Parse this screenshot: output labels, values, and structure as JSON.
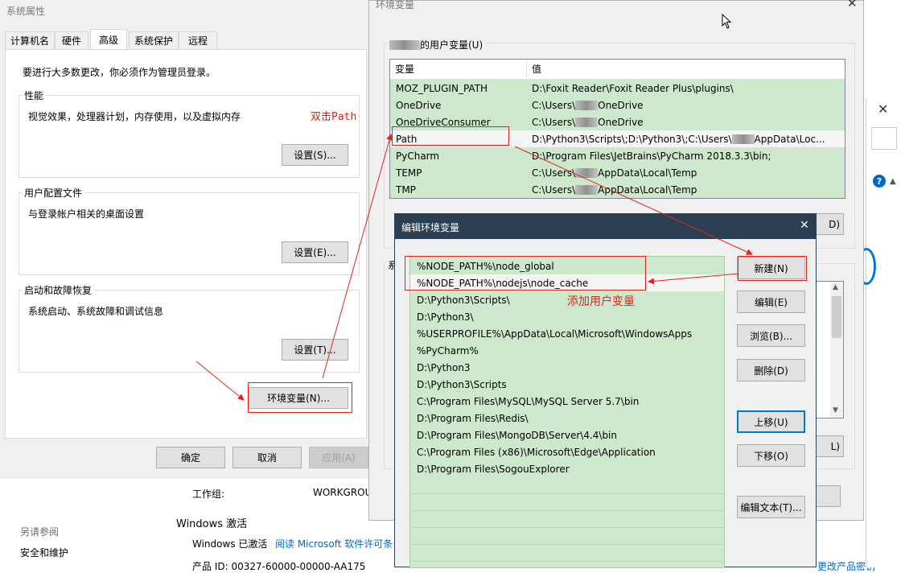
{
  "sysprop": {
    "title": "系统属性",
    "tabs": [
      "计算机名",
      "硬件",
      "高级",
      "系统保护",
      "远程"
    ],
    "admin_note": "要进行大多数更改，你必须作为管理员登录。",
    "perf_title": "性能",
    "perf_desc": "视觉效果，处理器计划，内存使用，以及虚拟内存",
    "perf_btn": "设置(S)...",
    "profile_title": "用户配置文件",
    "profile_desc": "与登录帐户相关的桌面设置",
    "profile_btn": "设置(E)...",
    "startup_title": "启动和故障恢复",
    "startup_desc": "系统启动、系统故障和调试信息",
    "startup_btn": "设置(T)...",
    "env_btn": "环境变量(N)...",
    "ok": "确定",
    "cancel": "取消",
    "apply": "应用(A)"
  },
  "background": {
    "workgroup_label": "工作组:",
    "workgroup_value": "WORKGROU",
    "see_also": "另请参阅",
    "security": "安全和维护",
    "activation_title": "Windows 激活",
    "activated": "Windows 已激活",
    "license_link": "阅读 Microsoft 软件许可条",
    "product_id": "产品 ID: 00327-60000-00000-AA175",
    "right_link": "更改产品密钥"
  },
  "envvars": {
    "title": "环境变量",
    "user_group_title": "的用户变量(U)",
    "col_var": "变量",
    "col_val": "值",
    "rows": [
      {
        "name": "MOZ_PLUGIN_PATH",
        "value": "D:\\Foxit Reader\\Foxit Reader Plus\\plugins\\"
      },
      {
        "name": "OneDrive",
        "value_a": "C:\\Users\\",
        "value_b": "OneDrive"
      },
      {
        "name": "OneDriveConsumer",
        "value_a": "C:\\Users\\",
        "value_b": "OneDrive"
      },
      {
        "name": "Path",
        "value_a": "D:\\Python3\\Scripts\\;D:\\Python3\\;C:\\Users\\",
        "value_b": "AppData\\Loc..."
      },
      {
        "name": "PyCharm",
        "value": "D:\\Program Files\\JetBrains\\PyCharm 2018.3.3\\bin;"
      },
      {
        "name": "TEMP",
        "value_a": "C:\\Users\\",
        "value_b": "AppData\\Local\\Temp"
      },
      {
        "name": "TMP",
        "value_a": "C:\\Users\\",
        "value_b": "AppData\\Local\\Temp"
      }
    ],
    "partial_btn_1": "D)",
    "partial_btn_2": "L)",
    "sys_group_partial": "系"
  },
  "editenv": {
    "title": "编辑环境变量",
    "items": [
      "%NODE_PATH%\\node_global",
      "%NODE_PATH%\\nodejs\\node_cache",
      "D:\\Python3\\Scripts\\",
      "D:\\Python3\\",
      "%USERPROFILE%\\AppData\\Local\\Microsoft\\WindowsApps",
      "%PyCharm%",
      "D:\\Python3",
      "D:\\Python3\\Scripts",
      "C:\\Program Files\\MySQL\\MySQL Server 5.7\\bin",
      "D:\\Program Files\\Redis\\",
      "D:\\Program Files\\MongoDB\\Server\\4.4\\bin",
      "C:\\Program Files (x86)\\Microsoft\\Edge\\Application",
      "D:\\Program Files\\SogouExplorer"
    ],
    "btn_new": "新建(N)",
    "btn_edit": "编辑(E)",
    "btn_browse": "浏览(B)...",
    "btn_delete": "删除(D)",
    "btn_up": "上移(U)",
    "btn_down": "下移(O)",
    "btn_edit_text": "编辑文本(T)..."
  },
  "annotations": {
    "double_click": "双击Path",
    "add_user_var": "添加用户变量"
  },
  "colors": {
    "highlight_green": "#cde8cd",
    "annotation_red": "#e2231a",
    "dialog_title_bar": "#2b3f52"
  }
}
